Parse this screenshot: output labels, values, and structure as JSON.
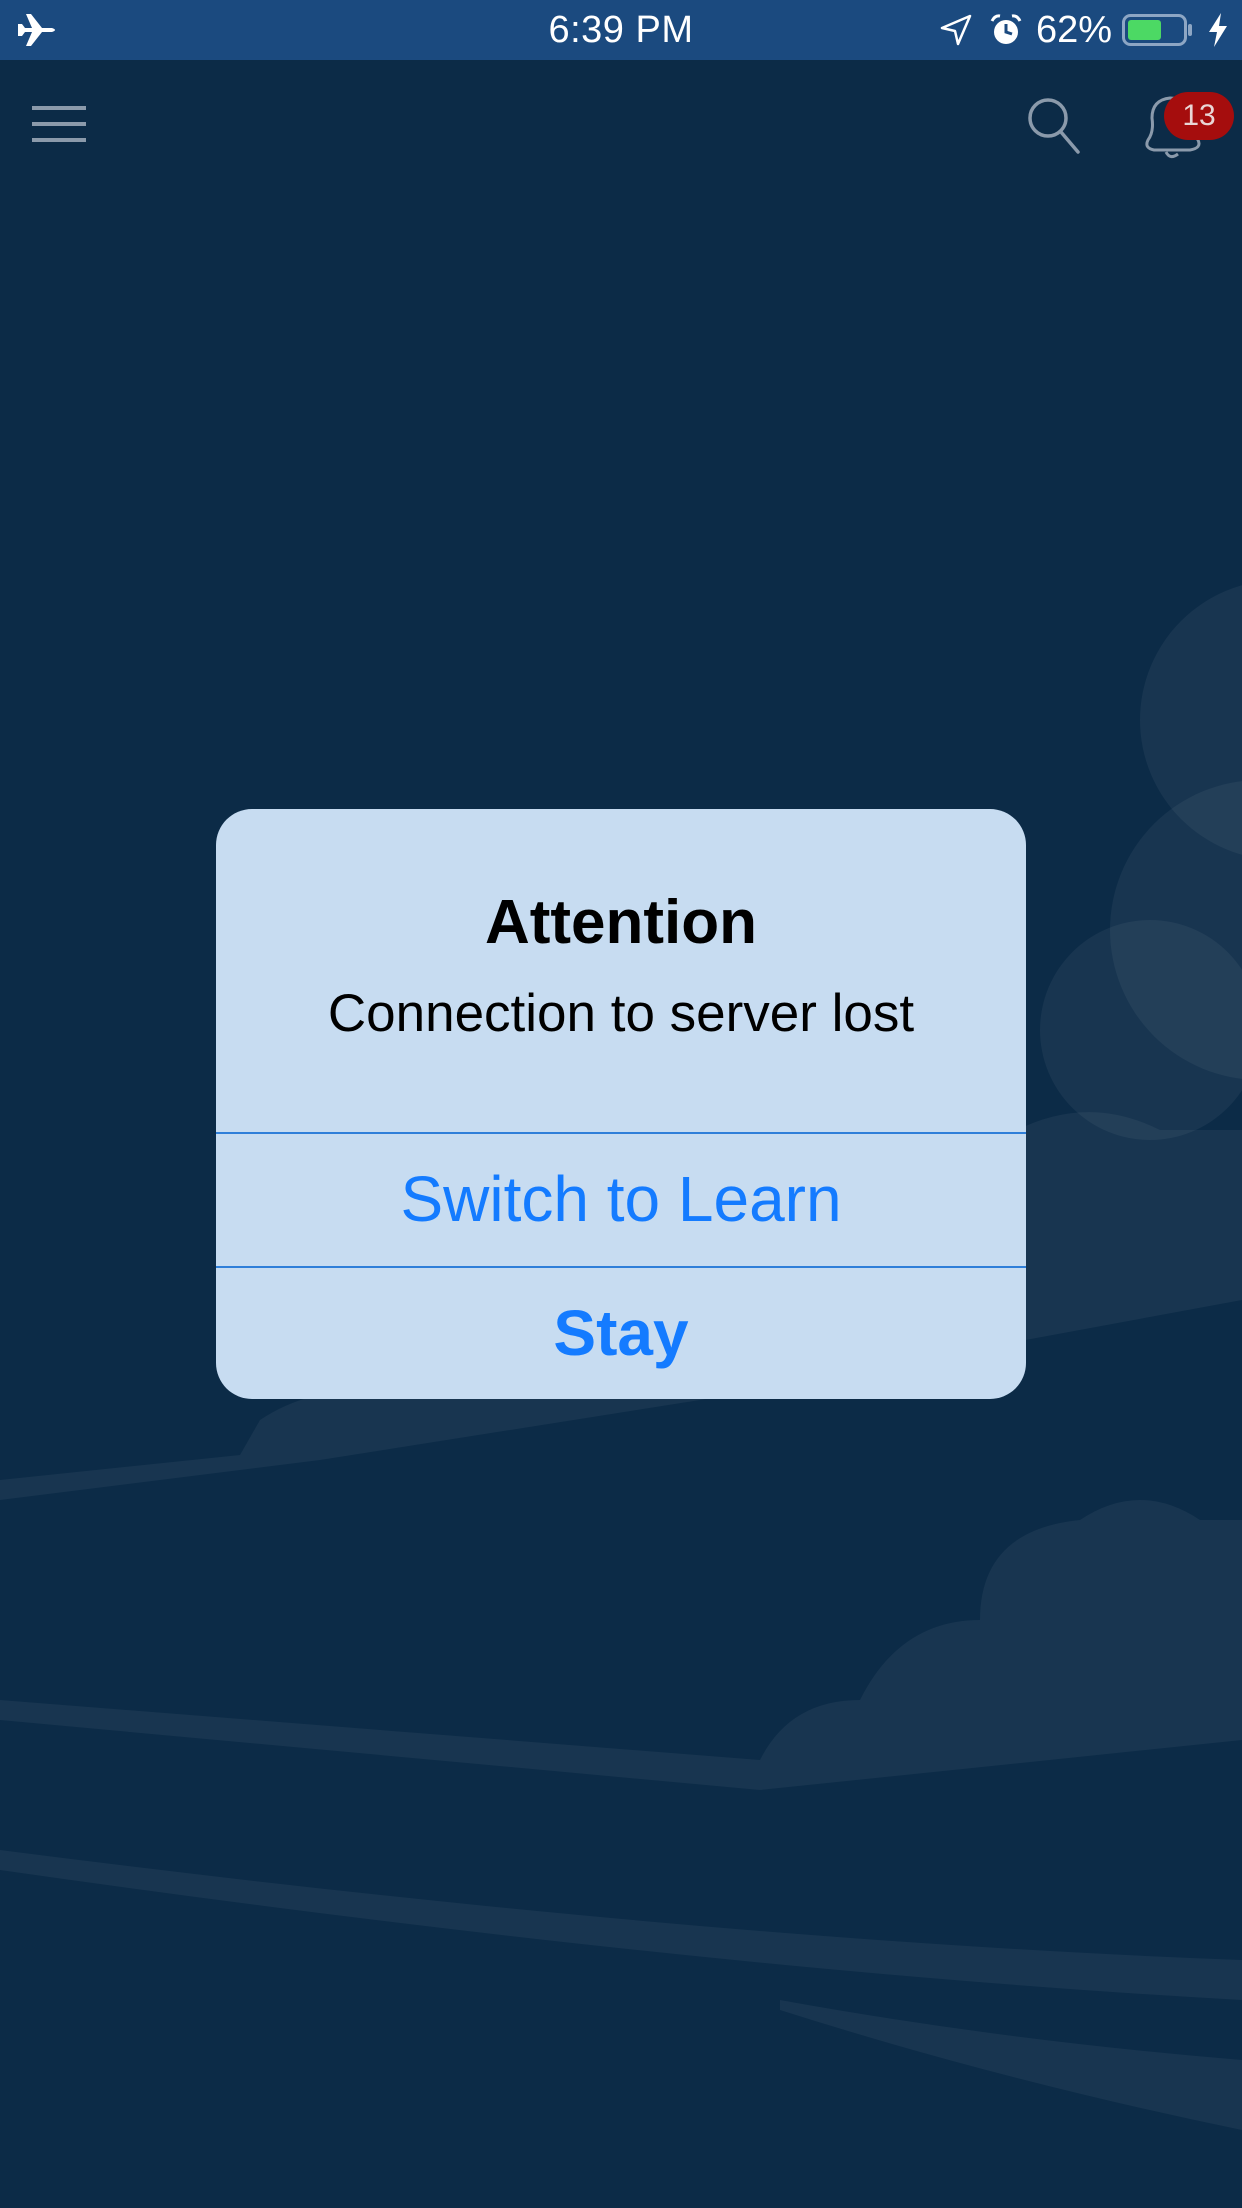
{
  "status_bar": {
    "time": "6:39 PM",
    "battery_percent": "62%",
    "battery_level": 0.62,
    "icons": [
      "airplane-icon",
      "location-arrow-icon",
      "alarm-icon",
      "battery-icon",
      "charging-bolt-icon"
    ]
  },
  "nav_bar": {
    "icons": [
      "menu-icon",
      "search-icon",
      "bell-icon"
    ],
    "notification_count": "13"
  },
  "alert": {
    "title": "Attention",
    "message": "Connection to server lost",
    "buttons": [
      {
        "label": "Switch to Learn",
        "style": "default"
      },
      {
        "label": "Stay",
        "style": "preferred"
      }
    ]
  },
  "colors": {
    "background": "#0c2b47",
    "status_bar": "#1b4a7f",
    "alert_background": "#c7dcf1",
    "action_blue": "#147bff",
    "badge_red": "#a50d0d",
    "battery_green": "#4cd964"
  }
}
